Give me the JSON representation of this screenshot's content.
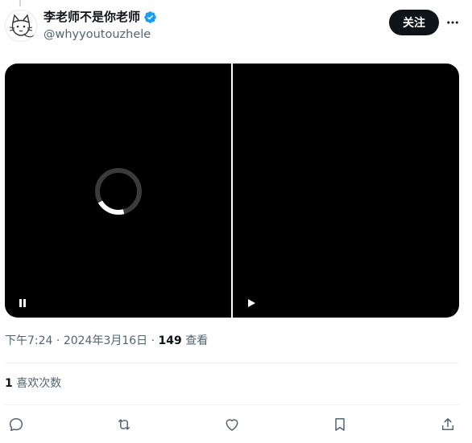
{
  "author": {
    "display_name": "李老师不是你老师",
    "handle": "@whyyoutouzhele",
    "verified": true
  },
  "header": {
    "follow_label": "关注",
    "more_icon": "more-icon"
  },
  "media": {
    "videos": [
      {
        "state": "loading",
        "control_icon": "pause-icon"
      },
      {
        "state": "paused",
        "control_icon": "play-icon"
      }
    ]
  },
  "meta": {
    "time": "下午7:24",
    "separator": " · ",
    "date": "2024年3月16日",
    "views_count": "149",
    "views_label": " 查看"
  },
  "stats": {
    "likes_count": "1",
    "likes_label": " 喜欢次数"
  },
  "actions": [
    "reply-icon",
    "retweet-icon",
    "like-icon",
    "bookmark-icon",
    "share-icon"
  ],
  "colors": {
    "text_primary": "#0f1419",
    "text_secondary": "#536471",
    "verified": "#1d9bf0",
    "divider": "#eff3f4"
  }
}
